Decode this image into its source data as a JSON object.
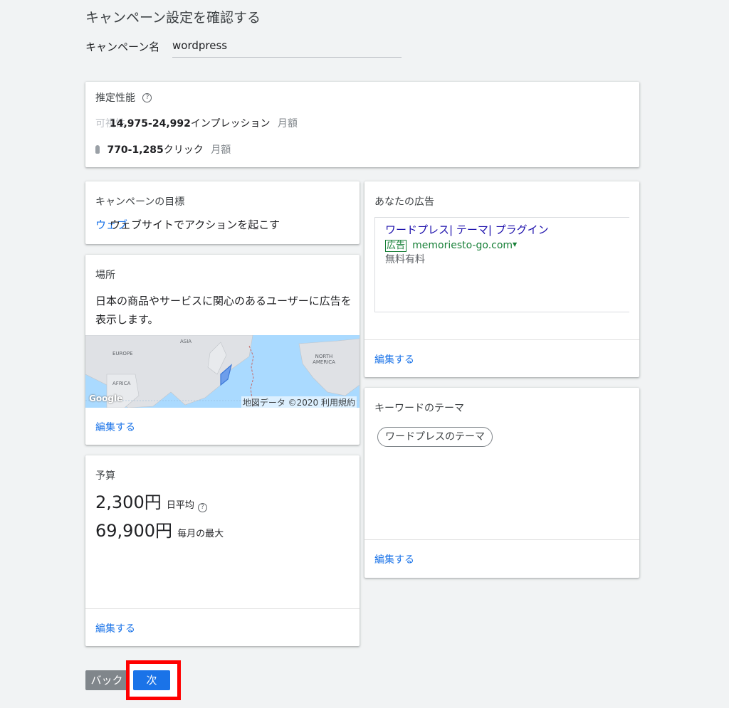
{
  "page": {
    "title": "キャンペーン設定を確認する",
    "campaign_name_label": "キャンペーン名",
    "campaign_name_value": "wordpress"
  },
  "performance": {
    "title": "推定性能",
    "impressions_range": "14,975-24,992",
    "impressions_unit": "インプレッション",
    "impressions_period": "月額",
    "impressions_hint": "可視性",
    "clicks_range": "770-1,285",
    "clicks_unit": "クリック",
    "clicks_period": "月額"
  },
  "goal": {
    "title": "キャンペーンの目標",
    "value": "ウェブサイトでアクションを起こす",
    "link_overlap": "ウェブ"
  },
  "location": {
    "title": "場所",
    "description": "日本の商品やサービスに関心のあるユーザーに広告を表示します。",
    "map_labels": [
      "ASIA",
      "EUROPE",
      "AFRICA",
      "NORTH AMERICA"
    ],
    "map_logo": "Google",
    "map_attribution": "地図データ ©2020 利用規約",
    "edit": "編集する"
  },
  "budget": {
    "title": "予算",
    "daily_amount": "2,300円",
    "daily_label": "日平均",
    "monthly_amount": "69,900円",
    "monthly_label": "毎月の最大",
    "edit": "編集する"
  },
  "ad": {
    "title": "あなたの広告",
    "headline": "ワードプレス| テーマ| プラグイン",
    "badge": "広告",
    "url": "memoriesto-go.com",
    "description": "無料有料",
    "edit": "編集する"
  },
  "keywords": {
    "title": "キーワードのテーマ",
    "chips": [
      "ワードプレスのテーマ"
    ],
    "edit": "編集する"
  },
  "footer": {
    "back": "バック",
    "next": "次"
  },
  "colors": {
    "link": "#1a73e8",
    "ad_headline": "#1a0dab",
    "ad_url": "#188038",
    "primary_button": "#1a73e8",
    "highlight": "#ff0000",
    "map_water": "#aadaff"
  }
}
